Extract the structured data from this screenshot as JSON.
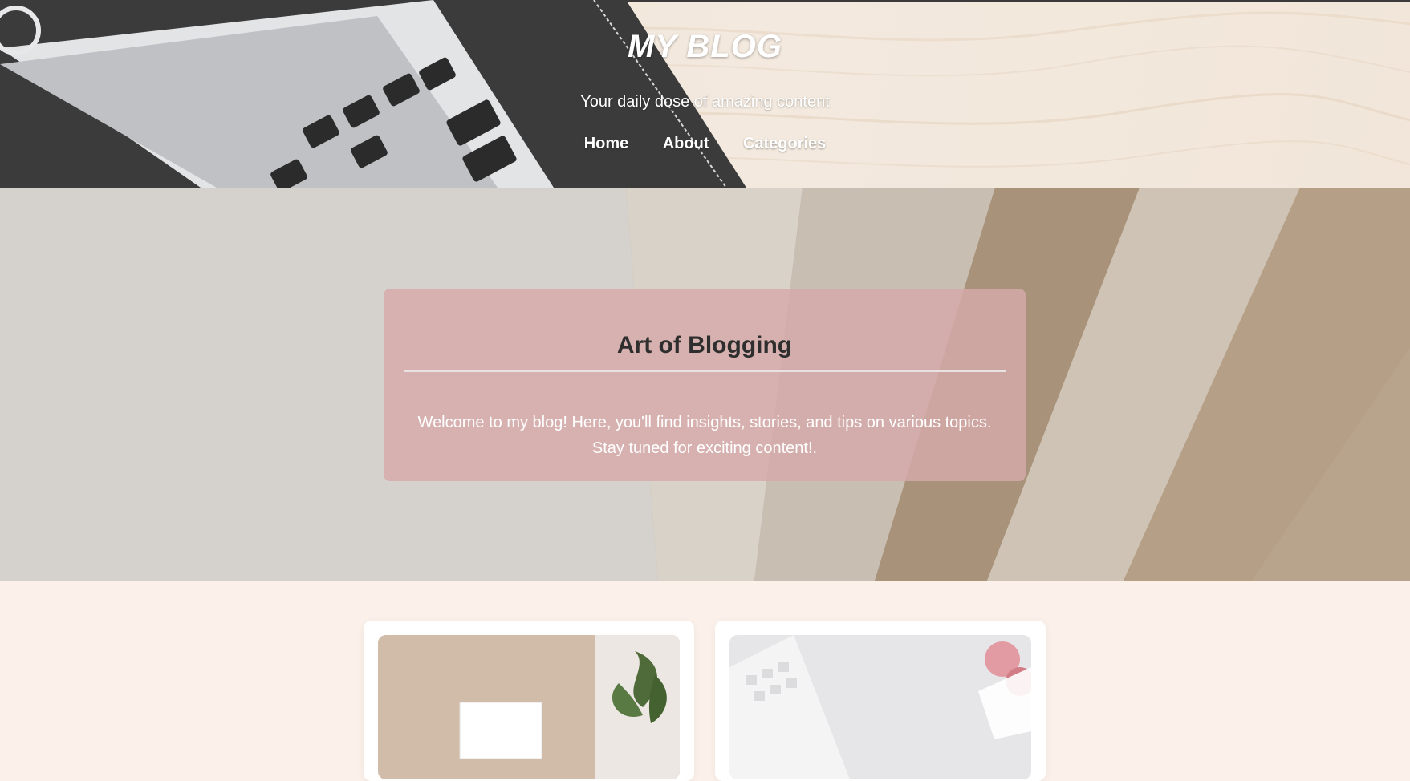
{
  "header": {
    "site_title": "MY BLOG",
    "tagline": "Your daily dose of amazing content",
    "nav": [
      "Home",
      "About",
      "Categories"
    ]
  },
  "hero": {
    "title": "Art of Blogging",
    "text": "Welcome to my blog! Here, you'll find insights, stories, and tips on various topics. Stay tuned for exciting content!."
  },
  "colors": {
    "page_background": "#fcf1ea",
    "hero_box": "#d6aaaa",
    "text_light": "#ffffff",
    "title_dark": "#2e2e2e"
  },
  "icons": [
    "laptop-photo",
    "plant-photo",
    "keyboard-photo"
  ]
}
